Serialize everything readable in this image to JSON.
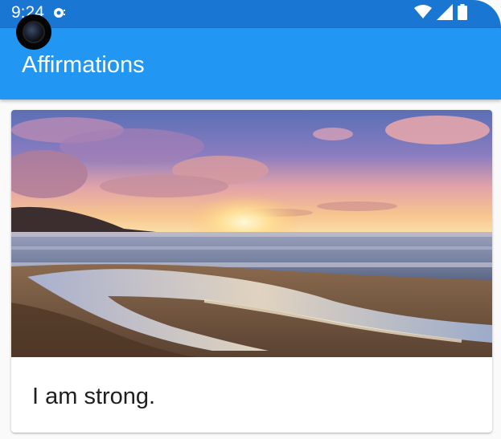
{
  "status_bar": {
    "time": "9:24",
    "icons": [
      "notification-icon",
      "wifi-icon",
      "signal-icon",
      "battery-icon"
    ],
    "color": "#1976d2"
  },
  "app_bar": {
    "title": "Affirmations",
    "color": "#2196f3"
  },
  "cards": [
    {
      "image": "sunset-beach-image",
      "text": "I am strong."
    }
  ]
}
